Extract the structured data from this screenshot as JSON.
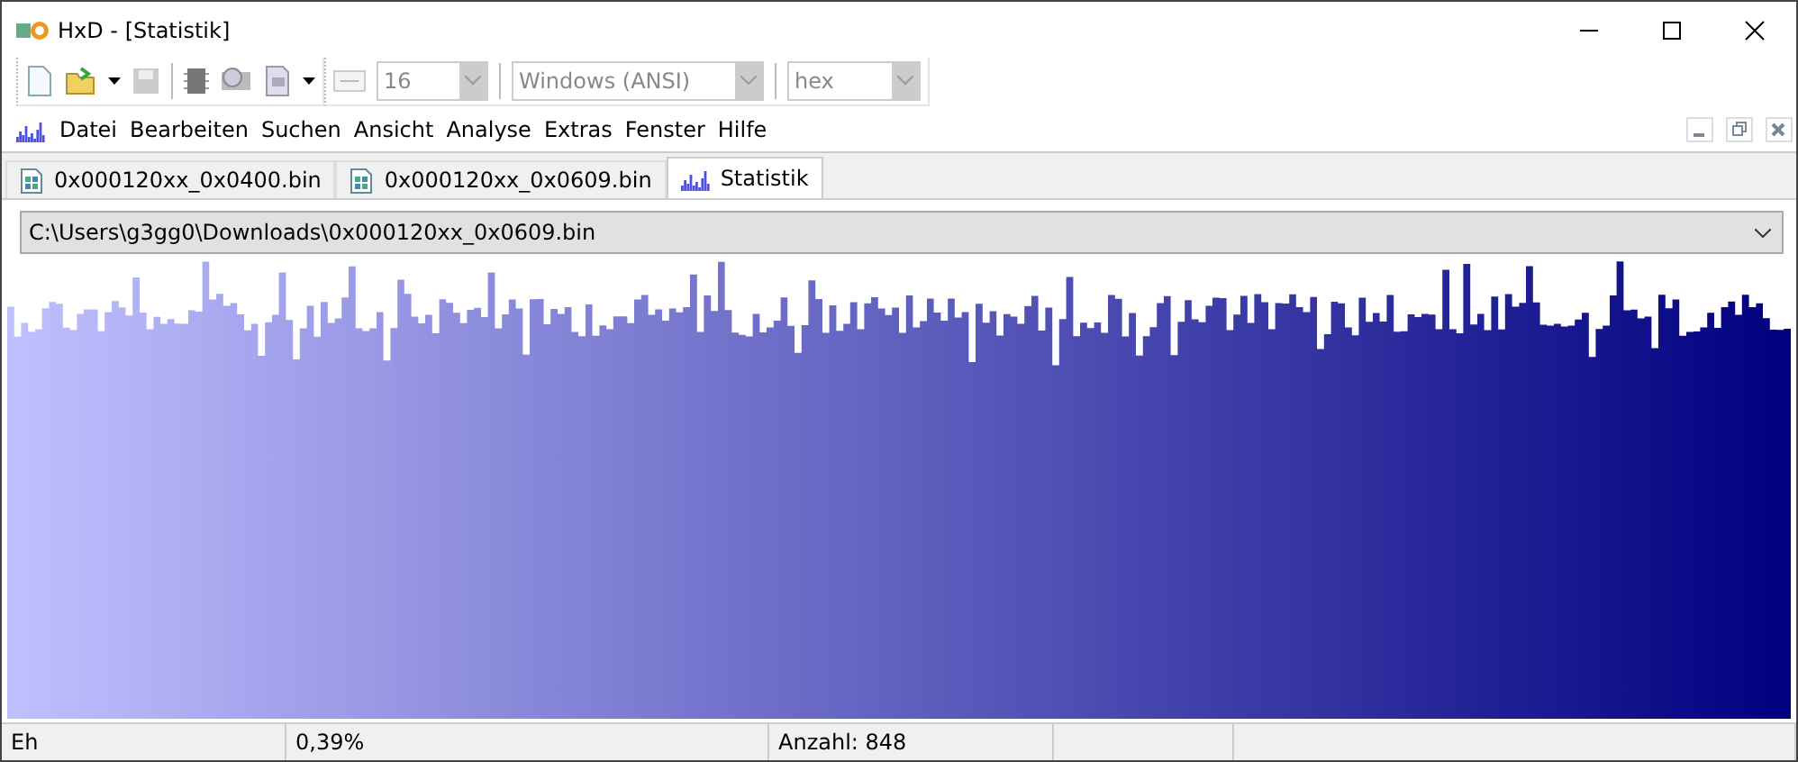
{
  "window": {
    "title": "HxD - [Statistik]"
  },
  "toolbar": {
    "combos": [
      {
        "value": "16",
        "disabled": true
      },
      {
        "value": "Windows (ANSI)",
        "disabled": true
      },
      {
        "value": "hex",
        "disabled": true
      }
    ]
  },
  "menu": [
    "Datei",
    "Bearbeiten",
    "Suchen",
    "Ansicht",
    "Analyse",
    "Extras",
    "Fenster",
    "Hilfe"
  ],
  "tabs": [
    {
      "label": "0x000120xx_0x0400.bin",
      "kind": "file",
      "selected": false
    },
    {
      "label": "0x000120xx_0x0609.bin",
      "kind": "file",
      "selected": false
    },
    {
      "label": "Statistik",
      "kind": "stats",
      "selected": true
    }
  ],
  "file_selector": {
    "value": "C:\\Users\\g3gg0\\Downloads\\0x000120xx_0x0609.bin"
  },
  "status_bar": [
    "Eh",
    "0,39%",
    "Anzahl: 848"
  ]
}
